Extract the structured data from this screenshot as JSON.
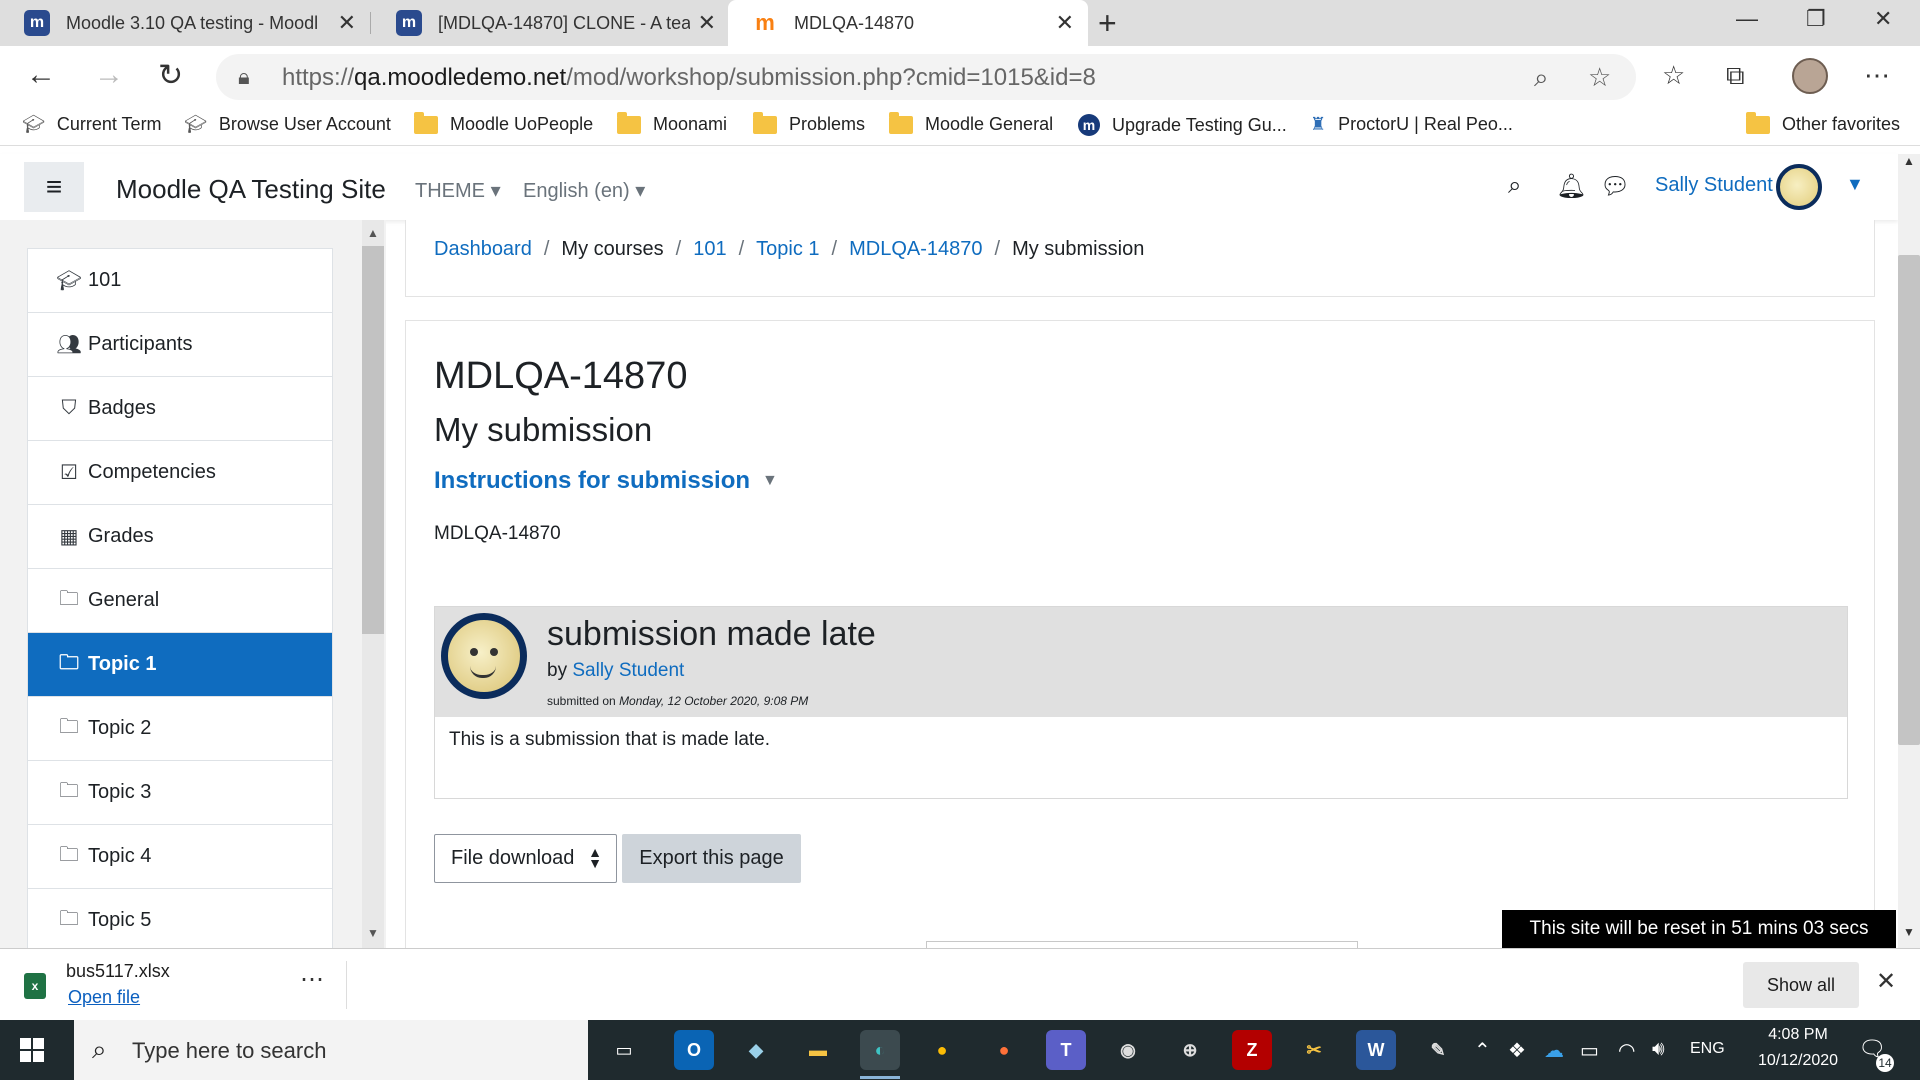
{
  "browser": {
    "tabs": [
      {
        "title": "Moodle 3.10 QA testing - Moodl",
        "icon": "moodle-blue-icon"
      },
      {
        "title": "[MDLQA-14870] CLONE - A teac",
        "icon": "moodle-blue-icon"
      },
      {
        "title": "MDLQA-14870",
        "icon": "moodle-orange-icon"
      }
    ],
    "url_prefix": "https://",
    "url_host": "qa.moodledemo.net",
    "url_path": "/mod/workshop/submission.php?cmid=1015&id=8",
    "bookmarks": [
      {
        "label": "Current Term",
        "icon": "mortarboard-icon"
      },
      {
        "label": "Browse User Account",
        "icon": "mortarboard-icon"
      },
      {
        "label": "Moodle UoPeople",
        "icon": "folder-icon"
      },
      {
        "label": "Moonami",
        "icon": "folder-icon"
      },
      {
        "label": "Problems",
        "icon": "folder-icon"
      },
      {
        "label": "Moodle General",
        "icon": "folder-icon"
      },
      {
        "label": "Upgrade Testing Gu...",
        "icon": "moodle-m-icon"
      },
      {
        "label": "ProctorU | Real Peo...",
        "icon": "owl-icon"
      }
    ],
    "other_favorites": "Other favorites"
  },
  "moodle_nav": {
    "site_name": "Moodle QA Testing Site",
    "theme_label": "THEME",
    "language_label": "English (en)",
    "user_name": "Sally Student"
  },
  "drawer": {
    "items": [
      {
        "label": "101",
        "icon": "graduation-cap-icon"
      },
      {
        "label": "Participants",
        "icon": "users-icon"
      },
      {
        "label": "Badges",
        "icon": "shield-icon"
      },
      {
        "label": "Competencies",
        "icon": "check-square-icon"
      },
      {
        "label": "Grades",
        "icon": "table-icon"
      },
      {
        "label": "General",
        "icon": "folder-icon"
      },
      {
        "label": "Topic 1",
        "icon": "folder-icon"
      },
      {
        "label": "Topic 2",
        "icon": "folder-icon"
      },
      {
        "label": "Topic 3",
        "icon": "folder-icon"
      },
      {
        "label": "Topic 4",
        "icon": "folder-icon"
      },
      {
        "label": "Topic 5",
        "icon": "folder-icon"
      }
    ],
    "active_label": "Topic 1"
  },
  "breadcrumb": [
    {
      "label": "Dashboard",
      "link": true
    },
    {
      "label": "My courses",
      "link": false
    },
    {
      "label": "101",
      "link": true
    },
    {
      "label": "Topic 1",
      "link": true
    },
    {
      "label": "MDLQA-14870",
      "link": true
    },
    {
      "label": "My submission",
      "link": false
    }
  ],
  "main": {
    "activity_title": "MDLQA-14870",
    "page_subtitle": "My submission",
    "instructions_toggle": "Instructions for submission",
    "instructions_text": "MDLQA-14870",
    "submission": {
      "title": "submission made late",
      "by_prefix": "by",
      "author": "Sally Student",
      "submitted_prefix": "submitted on",
      "submitted_date": "Monday, 12 October 2020, 9:08 PM",
      "content": "This is a submission that is made late."
    },
    "export_select_value": "File download",
    "export_button": "Export this page"
  },
  "reset_banner": "This site will be reset in 51 mins 03 secs",
  "download_bar": {
    "filename": "bus5117.xlsx",
    "open_label": "Open file",
    "show_all": "Show all"
  },
  "taskbar": {
    "search_placeholder": "Type here to search",
    "language": "ENG",
    "time": "4:08 PM",
    "date": "10/12/2020",
    "notification_count": "14"
  }
}
